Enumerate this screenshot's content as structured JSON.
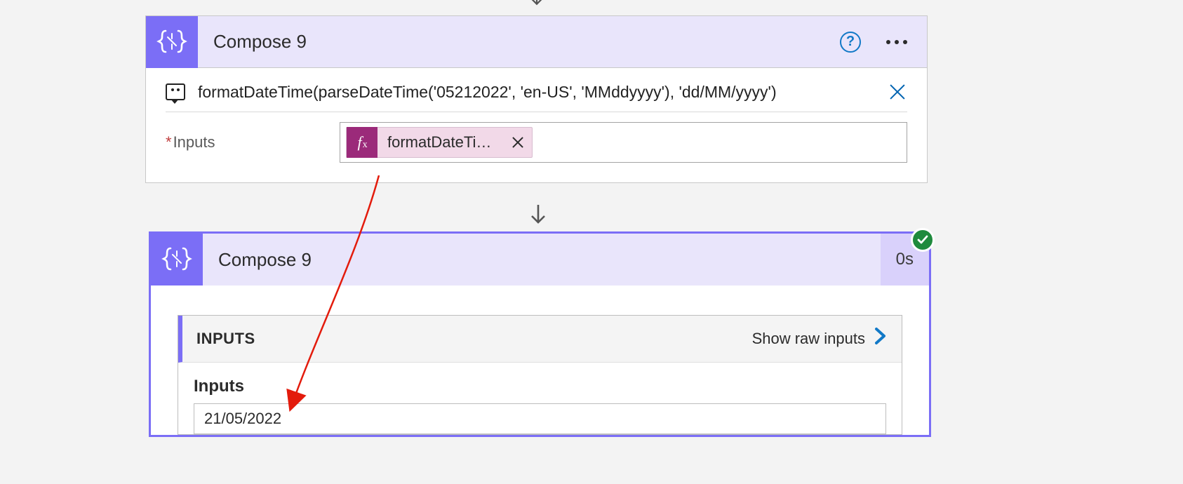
{
  "card1": {
    "title": "Compose 9",
    "comment": "formatDateTime(parseDateTime('05212022', 'en-US', 'MMddyyyy'), 'dd/MM/yyyy')",
    "inputs_label": "Inputs",
    "token_label": "formatDateTim…"
  },
  "card2": {
    "title": "Compose 9",
    "elapsed": "0s",
    "panel_title": "INPUTS",
    "show_raw_label": "Show raw inputs",
    "result_field_label": "Inputs",
    "result_value": "21/05/2022"
  }
}
